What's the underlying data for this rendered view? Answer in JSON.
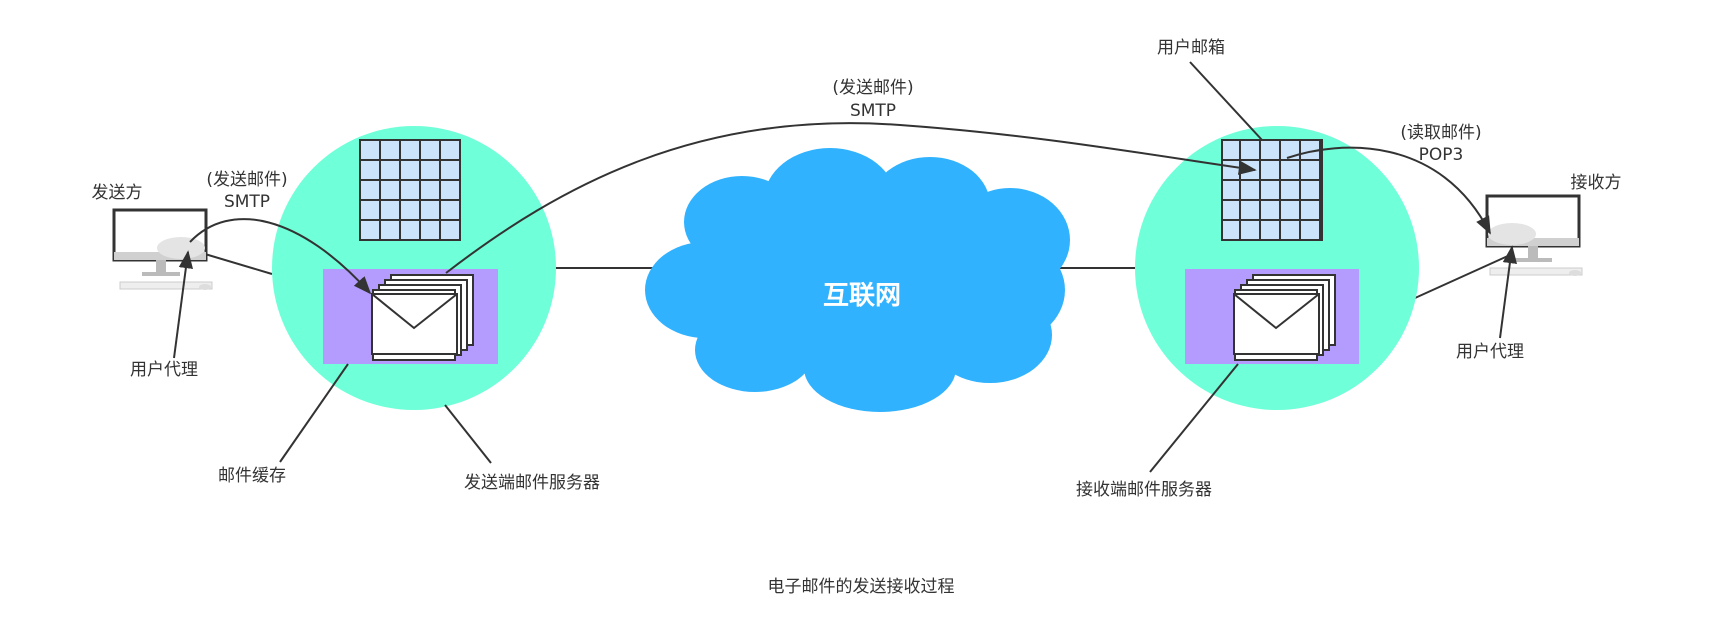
{
  "diagram": {
    "caption": "电子邮件的发送接收过程",
    "internet_label": "互联网",
    "sender": {
      "label": "发送方",
      "user_agent_label": "用户代理",
      "smtp_line1": "(发送邮件)",
      "smtp_line2": "SMTP"
    },
    "sender_server": {
      "label": "发送端邮件服务器",
      "cache_label": "邮件缓存"
    },
    "middle": {
      "smtp_line1": "(发送邮件)",
      "smtp_line2": "SMTP"
    },
    "receiver_server": {
      "label": "接收端邮件服务器",
      "mailbox_label": "用户邮箱"
    },
    "receiver": {
      "label": "接收方",
      "user_agent_label": "用户代理",
      "pop3_line1": "(读取邮件)",
      "pop3_line2": "POP3"
    }
  },
  "colors": {
    "server_circle": "#6fffd9",
    "mail_cache_box": "#b49cff",
    "grid_fill": "#cce4fb",
    "cloud": "#31b2ff",
    "line": "#333333"
  }
}
